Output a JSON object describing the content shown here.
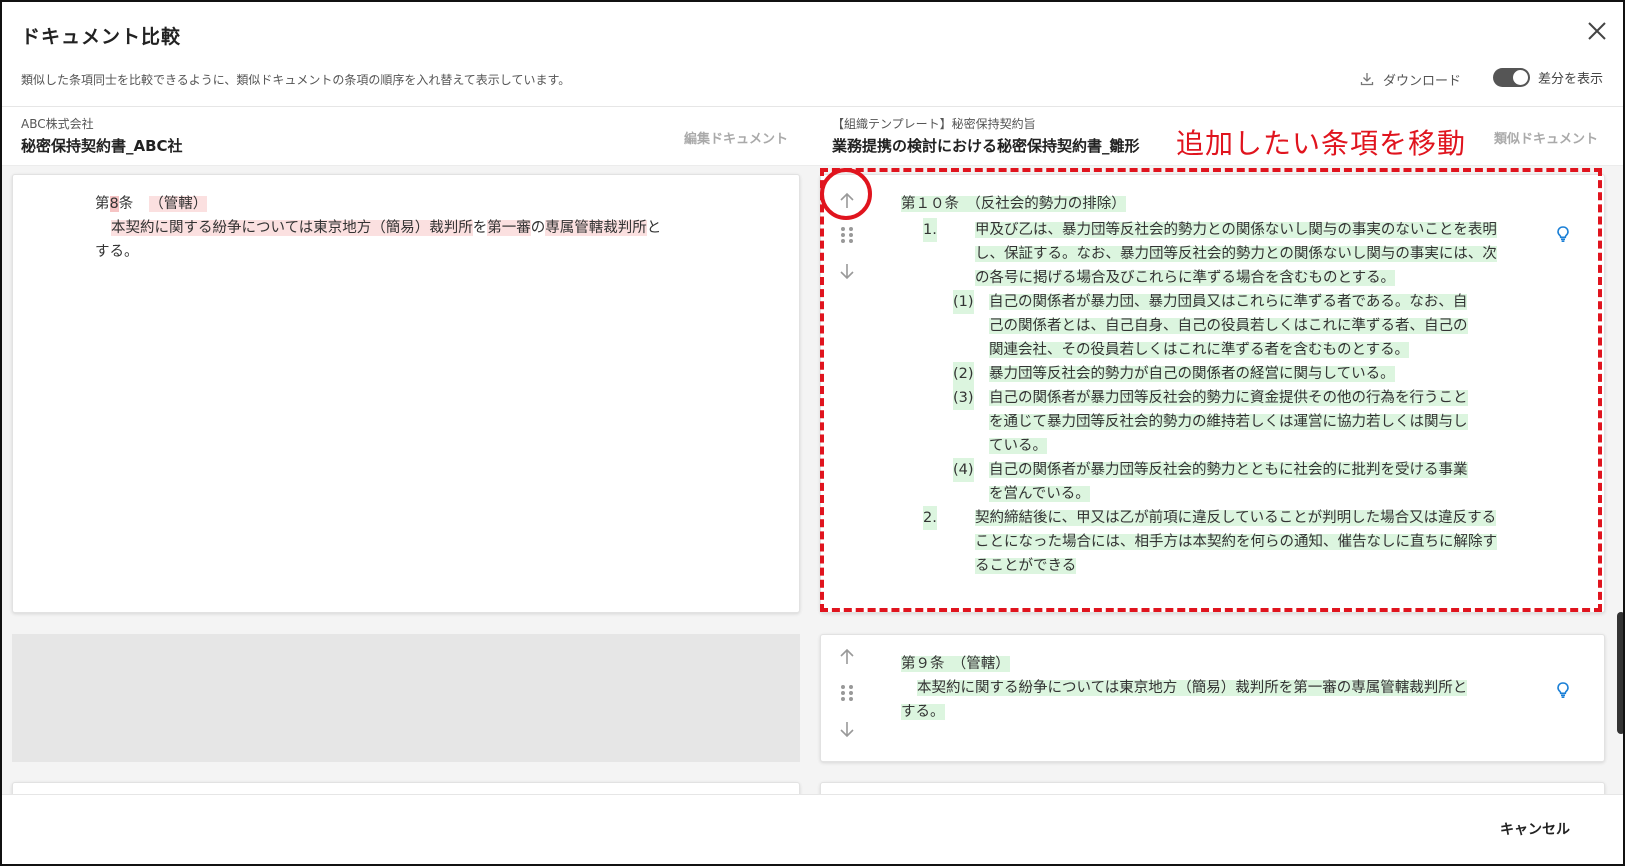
{
  "dialog": {
    "title": "ドキュメント比較",
    "subtitle": "類似した条項同士を比較できるように、類似ドキュメントの条項の順序を入れ替えて表示しています。",
    "download_label": "ダウンロード",
    "diff_toggle_label": "差分を表示",
    "diff_toggle_on": true,
    "cancel_label": "キャンセル"
  },
  "left_doc": {
    "company": "ABC株式会社",
    "name": "秘密保持契約書_ABC社",
    "role": "編集ドキュメント",
    "clause": {
      "prefix": "第",
      "number": "8",
      "suffix": "条",
      "heading": "（管轄）",
      "body_line1_parts": [
        "本契約に関する紛争については",
        "東京地方（簡易）裁判所",
        "を",
        "第一審",
        "の",
        "専属管轄裁判所",
        "と"
      ],
      "body_line2": "する。"
    }
  },
  "right_doc": {
    "company": "【組織テンプレート】秘密保持契約旨",
    "name": "業務提携の検討における秘密保持契約書_雛形",
    "role": "類似ドキュメント",
    "clause1": {
      "heading": "第１０条　（反社会的勢力の排除）",
      "items": [
        {
          "num": "1.",
          "lines": [
            "甲及び乙は、暴力団等反社会的勢力との関係ないし関与の事実のないことを表明",
            "し、保証する。なお、暴力団等反社会的勢力との関係ないし関与の事実には、次",
            "の各号に掲げる場合及びこれらに準ずる場合を含むものとする。"
          ]
        },
        {
          "num": "(1)",
          "lines": [
            "自己の関係者が暴力団、暴力団員又はこれらに準ずる者である。なお、自",
            "己の関係者とは、自己自身、自己の役員若しくはこれに準ずる者、自己の",
            "関連会社、その役員若しくはこれに準ずる者を含むものとする。"
          ]
        },
        {
          "num": "(2)",
          "lines": [
            "暴力団等反社会的勢力が自己の関係者の経営に関与している。"
          ]
        },
        {
          "num": "(3)",
          "lines": [
            "自己の関係者が暴力団等反社会的勢力に資金提供その他の行為を行うこと",
            "を通じて暴力団等反社会的勢力の維持若しくは運営に協力若しくは関与し",
            "ている。"
          ]
        },
        {
          "num": "(4)",
          "lines": [
            "自己の関係者が暴力団等反社会的勢力とともに社会的に批判を受ける事業",
            "を営んでいる。"
          ]
        },
        {
          "num": "2.",
          "lines": [
            "契約締結後に、甲又は乙が前項に違反していることが判明した場合又は違反する",
            "ことになった場合には、相手方は本契約を何らの通知、催告なしに直ちに解除す",
            "ることができる"
          ]
        }
      ]
    },
    "clause2": {
      "heading": "第９条　（管轄）",
      "line1": "本契約に関する紛争については東京地方（簡易）裁判所を第一審の専属管轄裁判所と",
      "line2": "する。"
    }
  },
  "annotation": {
    "text": "追加したい条項を移動",
    "color": "#e0141e"
  },
  "colors": {
    "accent_blue": "#1a7fd6",
    "diff_removed": "#fbe0e0",
    "diff_added": "#dcf5df"
  }
}
